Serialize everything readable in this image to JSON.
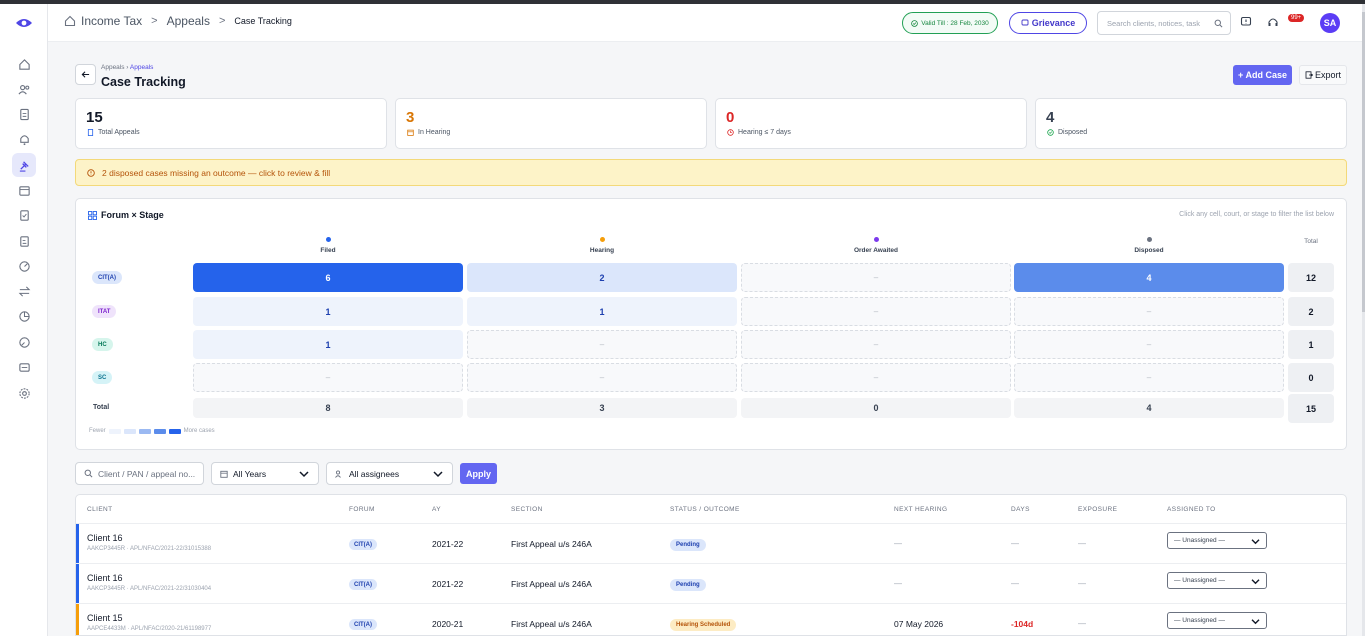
{
  "header": {
    "crumb_root": "Income Tax",
    "crumb_mid": "Appeals",
    "crumb_current": "Case Tracking",
    "valid_till": "Valid Till : 28 Feb, 2030",
    "grievance": "Grievance",
    "search_placeholder": "Search clients, notices, task",
    "notif_badge": "99+",
    "avatar": "SA"
  },
  "page": {
    "sub_crumb_root": "Appeals",
    "sub_crumb_sep": " › ",
    "sub_crumb_cur": "Appeals",
    "title": "Case Tracking",
    "add_case": "+ Add Case",
    "export": "Export"
  },
  "stats": [
    {
      "value": "15",
      "label": "Total Appeals",
      "color": "#111827",
      "icon": "file-icon"
    },
    {
      "value": "3",
      "label": "In Hearing",
      "color": "#d97706",
      "icon": "calendar-icon"
    },
    {
      "value": "0",
      "label": "Hearing ≤ 7 days",
      "color": "#dc2626",
      "icon": "clock-icon"
    },
    {
      "value": "4",
      "label": "Disposed",
      "color": "#374151",
      "icon": "check-circle-icon"
    }
  ],
  "alert": "2 disposed cases missing an outcome — click to review & fill",
  "matrix": {
    "title": "Forum × Stage",
    "hint": "Click any cell, court, or stage to filter the list below",
    "columns": [
      {
        "label": "Filed",
        "dot": "#2563eb"
      },
      {
        "label": "Hearing",
        "dot": "#f59e0b"
      },
      {
        "label": "Order Awaited",
        "dot": "#7c3aed"
      },
      {
        "label": "Disposed",
        "dot": "#6b7280"
      }
    ],
    "total_label": "Total",
    "rows": [
      {
        "forum": "CIT(A)",
        "pill_bg": "#dbe6fb",
        "pill_fg": "#1e40af",
        "cells": [
          "6",
          "2",
          "–",
          "4"
        ],
        "total": "12"
      },
      {
        "forum": "ITAT",
        "pill_bg": "#efe3fb",
        "pill_fg": "#7e22ce",
        "cells": [
          "1",
          "1",
          "–",
          "–"
        ],
        "total": "2"
      },
      {
        "forum": "HC",
        "pill_bg": "#d6f5ec",
        "pill_fg": "#047857",
        "cells": [
          "1",
          "–",
          "–",
          "–"
        ],
        "total": "1"
      },
      {
        "forum": "SC",
        "pill_bg": "#d5f3f7",
        "pill_fg": "#0e7490",
        "cells": [
          "–",
          "–",
          "–",
          "–"
        ],
        "total": "0"
      }
    ],
    "totals_row_label": "Total",
    "totals": [
      "8",
      "3",
      "0",
      "4"
    ],
    "grand_total": "15",
    "legend_fewer": "Fewer",
    "legend_more": "More cases"
  },
  "filters": {
    "search_placeholder": "Client / PAN / appeal no...",
    "years": "All Years",
    "assignees": "All assignees",
    "apply": "Apply"
  },
  "table": {
    "headers": [
      "CLIENT",
      "FORUM",
      "AY",
      "SECTION",
      "STATUS / OUTCOME",
      "NEXT HEARING",
      "DAYS",
      "EXPOSURE",
      "ASSIGNED TO"
    ],
    "rows": [
      {
        "client": "Client 16",
        "meta": "AAKCP3445R · APL/NFAC/2021-22/31015388",
        "forum": "CIT(A)",
        "ay": "2021-22",
        "section": "First Appeal u/s 246A",
        "status": "Pending",
        "status_bg": "#dbe6fb",
        "status_fg": "#1e40af",
        "next": "—",
        "days": "—",
        "exposure": "—",
        "assigned": "— Unassigned —",
        "accent": "#2563eb"
      },
      {
        "client": "Client 16",
        "meta": "AAKCP3445R · APL/NFAC/2021-22/31030404",
        "forum": "CIT(A)",
        "ay": "2021-22",
        "section": "First Appeal u/s 246A",
        "status": "Pending",
        "status_bg": "#dbe6fb",
        "status_fg": "#1e40af",
        "next": "—",
        "days": "—",
        "exposure": "—",
        "assigned": "— Unassigned —",
        "accent": "#2563eb"
      },
      {
        "client": "Client 15",
        "meta": "AAPCE4433M · APL/NFAC/2020-21/61198977",
        "forum": "CIT(A)",
        "ay": "2020-21",
        "section": "First Appeal u/s 246A",
        "status": "Hearing Scheduled",
        "status_bg": "#fdecc4",
        "status_fg": "#b45309",
        "next": "07 May 2026",
        "days": "-104d",
        "exposure": "—",
        "assigned": "— Unassigned —",
        "accent": "#f59e0b"
      }
    ]
  }
}
